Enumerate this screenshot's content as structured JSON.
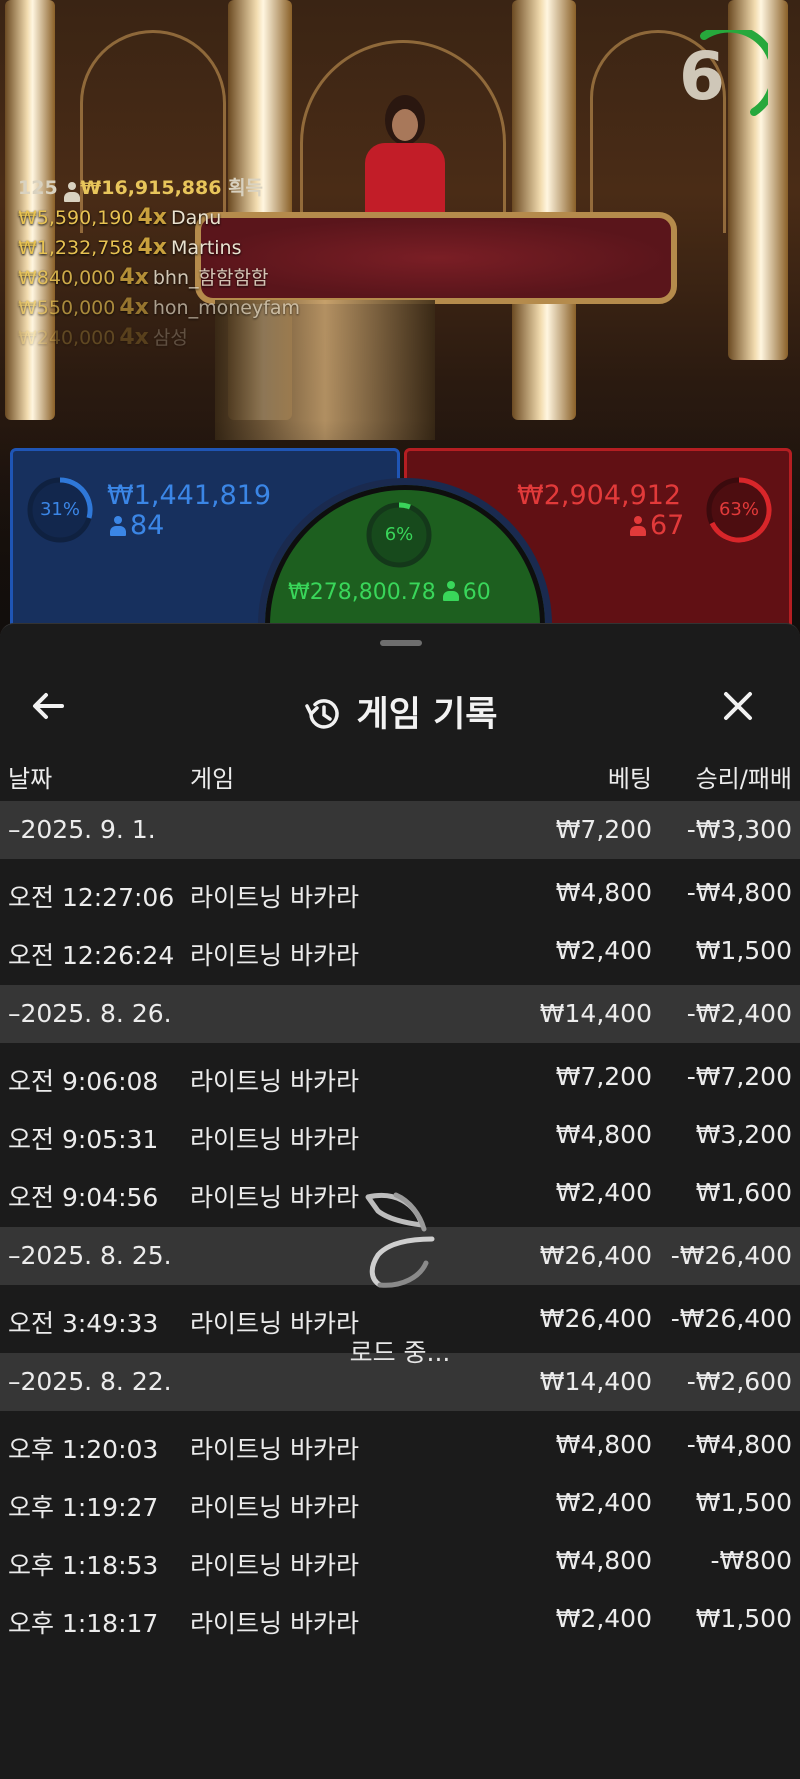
{
  "table": {
    "timer": "6",
    "winners_total": {
      "count": "125",
      "amount": "₩16,915,886",
      "label": "획득"
    },
    "winners": [
      {
        "amount": "₩5,590,190",
        "mult": "4x",
        "name": "Danu"
      },
      {
        "amount": "₩1,232,758",
        "mult": "4x",
        "name": "Martins"
      },
      {
        "amount": "₩840,000",
        "mult": "4x",
        "name": "bhn_함함함함"
      },
      {
        "amount": "₩550,000",
        "mult": "4x",
        "name": "hon_moneyfam"
      },
      {
        "amount": "₩240,000",
        "mult": "4x",
        "name": "삼성"
      }
    ],
    "player": {
      "percent": "31%",
      "amount": "₩1,441,819",
      "count": "84",
      "color": "#3b86e6"
    },
    "tie": {
      "percent": "6%",
      "amount": "₩278,800.78",
      "count": "60",
      "color": "#39d65a"
    },
    "banker": {
      "percent": "63%",
      "amount": "₩2,904,912",
      "count": "67",
      "color": "#e23a3a"
    }
  },
  "history": {
    "title": "게임 기록",
    "columns": {
      "date": "날짜",
      "game": "게임",
      "bet": "베팅",
      "winloss": "승리/패배"
    },
    "groups": [
      {
        "date": "–2025. 9. 1.",
        "bet": "₩7,200",
        "winloss": "-₩3,300",
        "items": [
          {
            "time": "오전 12:27:06",
            "game": "라이트닝 바카라",
            "bet": "₩4,800",
            "winloss": "-₩4,800"
          },
          {
            "time": "오전 12:26:24",
            "game": "라이트닝 바카라",
            "bet": "₩2,400",
            "winloss": "₩1,500"
          }
        ]
      },
      {
        "date": "–2025. 8. 26.",
        "bet": "₩14,400",
        "winloss": "-₩2,400",
        "items": [
          {
            "time": "오전 9:06:08",
            "game": "라이트닝 바카라",
            "bet": "₩7,200",
            "winloss": "-₩7,200"
          },
          {
            "time": "오전 9:05:31",
            "game": "라이트닝 바카라",
            "bet": "₩4,800",
            "winloss": "₩3,200"
          },
          {
            "time": "오전 9:04:56",
            "game": "라이트닝 바카라",
            "bet": "₩2,400",
            "winloss": "₩1,600"
          }
        ]
      },
      {
        "date": "–2025. 8. 25.",
        "bet": "₩26,400",
        "winloss": "-₩26,400",
        "items": [
          {
            "time": "오전 3:49:33",
            "game": "라이트닝 바카라",
            "bet": "₩26,400",
            "winloss": "-₩26,400"
          }
        ]
      },
      {
        "date": "–2025. 8. 22.",
        "bet": "₩14,400",
        "winloss": "-₩2,600",
        "items": [
          {
            "time": "오후 1:20:03",
            "game": "라이트닝 바카라",
            "bet": "₩4,800",
            "winloss": "-₩4,800"
          },
          {
            "time": "오후 1:19:27",
            "game": "라이트닝 바카라",
            "bet": "₩2,400",
            "winloss": "₩1,500"
          },
          {
            "time": "오후 1:18:53",
            "game": "라이트닝 바카라",
            "bet": "₩4,800",
            "winloss": "-₩800"
          },
          {
            "time": "오후 1:18:17",
            "game": "라이트닝 바카라",
            "bet": "₩2,400",
            "winloss": "₩1,500"
          }
        ]
      }
    ],
    "loading_text": "로드 중..."
  },
  "icons": {
    "back": "arrow-left-icon",
    "history": "history-clock-icon",
    "close": "close-icon",
    "loading": "loading-spinner-icon",
    "person": "person-icon"
  }
}
